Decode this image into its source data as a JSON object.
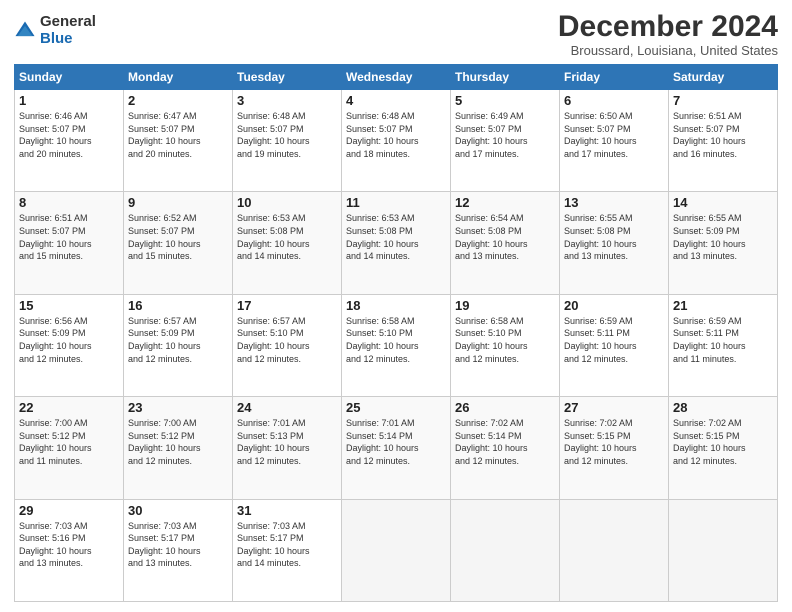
{
  "logo": {
    "general": "General",
    "blue": "Blue"
  },
  "title": "December 2024",
  "location": "Broussard, Louisiana, United States",
  "days_header": [
    "Sunday",
    "Monday",
    "Tuesday",
    "Wednesday",
    "Thursday",
    "Friday",
    "Saturday"
  ],
  "weeks": [
    [
      {
        "day": "1",
        "info": "Sunrise: 6:46 AM\nSunset: 5:07 PM\nDaylight: 10 hours\nand 20 minutes."
      },
      {
        "day": "2",
        "info": "Sunrise: 6:47 AM\nSunset: 5:07 PM\nDaylight: 10 hours\nand 20 minutes."
      },
      {
        "day": "3",
        "info": "Sunrise: 6:48 AM\nSunset: 5:07 PM\nDaylight: 10 hours\nand 19 minutes."
      },
      {
        "day": "4",
        "info": "Sunrise: 6:48 AM\nSunset: 5:07 PM\nDaylight: 10 hours\nand 18 minutes."
      },
      {
        "day": "5",
        "info": "Sunrise: 6:49 AM\nSunset: 5:07 PM\nDaylight: 10 hours\nand 17 minutes."
      },
      {
        "day": "6",
        "info": "Sunrise: 6:50 AM\nSunset: 5:07 PM\nDaylight: 10 hours\nand 17 minutes."
      },
      {
        "day": "7",
        "info": "Sunrise: 6:51 AM\nSunset: 5:07 PM\nDaylight: 10 hours\nand 16 minutes."
      }
    ],
    [
      {
        "day": "8",
        "info": "Sunrise: 6:51 AM\nSunset: 5:07 PM\nDaylight: 10 hours\nand 15 minutes."
      },
      {
        "day": "9",
        "info": "Sunrise: 6:52 AM\nSunset: 5:07 PM\nDaylight: 10 hours\nand 15 minutes."
      },
      {
        "day": "10",
        "info": "Sunrise: 6:53 AM\nSunset: 5:08 PM\nDaylight: 10 hours\nand 14 minutes."
      },
      {
        "day": "11",
        "info": "Sunrise: 6:53 AM\nSunset: 5:08 PM\nDaylight: 10 hours\nand 14 minutes."
      },
      {
        "day": "12",
        "info": "Sunrise: 6:54 AM\nSunset: 5:08 PM\nDaylight: 10 hours\nand 13 minutes."
      },
      {
        "day": "13",
        "info": "Sunrise: 6:55 AM\nSunset: 5:08 PM\nDaylight: 10 hours\nand 13 minutes."
      },
      {
        "day": "14",
        "info": "Sunrise: 6:55 AM\nSunset: 5:09 PM\nDaylight: 10 hours\nand 13 minutes."
      }
    ],
    [
      {
        "day": "15",
        "info": "Sunrise: 6:56 AM\nSunset: 5:09 PM\nDaylight: 10 hours\nand 12 minutes."
      },
      {
        "day": "16",
        "info": "Sunrise: 6:57 AM\nSunset: 5:09 PM\nDaylight: 10 hours\nand 12 minutes."
      },
      {
        "day": "17",
        "info": "Sunrise: 6:57 AM\nSunset: 5:10 PM\nDaylight: 10 hours\nand 12 minutes."
      },
      {
        "day": "18",
        "info": "Sunrise: 6:58 AM\nSunset: 5:10 PM\nDaylight: 10 hours\nand 12 minutes."
      },
      {
        "day": "19",
        "info": "Sunrise: 6:58 AM\nSunset: 5:10 PM\nDaylight: 10 hours\nand 12 minutes."
      },
      {
        "day": "20",
        "info": "Sunrise: 6:59 AM\nSunset: 5:11 PM\nDaylight: 10 hours\nand 12 minutes."
      },
      {
        "day": "21",
        "info": "Sunrise: 6:59 AM\nSunset: 5:11 PM\nDaylight: 10 hours\nand 11 minutes."
      }
    ],
    [
      {
        "day": "22",
        "info": "Sunrise: 7:00 AM\nSunset: 5:12 PM\nDaylight: 10 hours\nand 11 minutes."
      },
      {
        "day": "23",
        "info": "Sunrise: 7:00 AM\nSunset: 5:12 PM\nDaylight: 10 hours\nand 12 minutes."
      },
      {
        "day": "24",
        "info": "Sunrise: 7:01 AM\nSunset: 5:13 PM\nDaylight: 10 hours\nand 12 minutes."
      },
      {
        "day": "25",
        "info": "Sunrise: 7:01 AM\nSunset: 5:14 PM\nDaylight: 10 hours\nand 12 minutes."
      },
      {
        "day": "26",
        "info": "Sunrise: 7:02 AM\nSunset: 5:14 PM\nDaylight: 10 hours\nand 12 minutes."
      },
      {
        "day": "27",
        "info": "Sunrise: 7:02 AM\nSunset: 5:15 PM\nDaylight: 10 hours\nand 12 minutes."
      },
      {
        "day": "28",
        "info": "Sunrise: 7:02 AM\nSunset: 5:15 PM\nDaylight: 10 hours\nand 12 minutes."
      }
    ],
    [
      {
        "day": "29",
        "info": "Sunrise: 7:03 AM\nSunset: 5:16 PM\nDaylight: 10 hours\nand 13 minutes."
      },
      {
        "day": "30",
        "info": "Sunrise: 7:03 AM\nSunset: 5:17 PM\nDaylight: 10 hours\nand 13 minutes."
      },
      {
        "day": "31",
        "info": "Sunrise: 7:03 AM\nSunset: 5:17 PM\nDaylight: 10 hours\nand 14 minutes."
      },
      {
        "day": "",
        "info": ""
      },
      {
        "day": "",
        "info": ""
      },
      {
        "day": "",
        "info": ""
      },
      {
        "day": "",
        "info": ""
      }
    ]
  ]
}
